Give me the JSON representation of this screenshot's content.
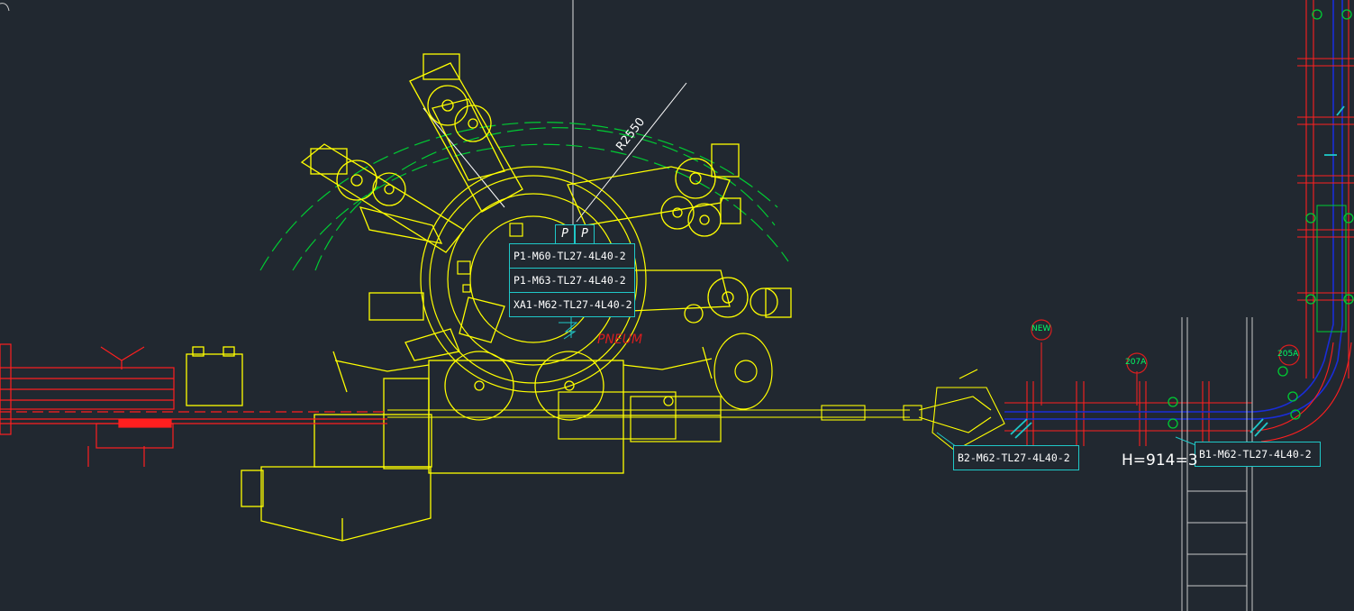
{
  "radius_label": "R2550",
  "tags": {
    "p1_m60": "P1-M60-TL27-4L40-2",
    "p1_m63": "P1-M63-TL27-4L40-2",
    "xa1_m62": "XA1-M62-TL27-4L40-2",
    "b2_m62": "B2-M62-TL27-4L40-2",
    "b1_m62": "B1-M62-TL27-4L40-2"
  },
  "bubbles": {
    "new": "NEW",
    "b207a": "207A",
    "b205a": "205A"
  },
  "p_markers": [
    "P",
    "P"
  ],
  "dimension_text": "H=914=3",
  "red_label": "PNEUM",
  "colors": {
    "background": "#212830",
    "machine": "#ffff00",
    "conveyor": "#ff1f1f",
    "range_arcs": "#00cc33",
    "tag_frame": "#1fc8c8",
    "guide": "#1a2dd8"
  }
}
